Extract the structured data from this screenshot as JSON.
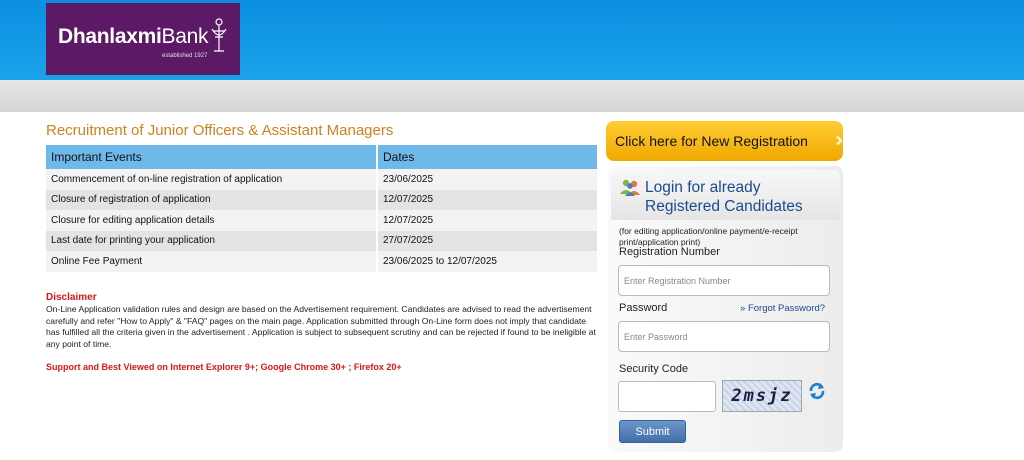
{
  "header": {
    "logo_name_bold": "Dhanlaxmi",
    "logo_name_light": "Bank",
    "logo_tagline": "established 1927",
    "colors": {
      "header_blue": "#0b8ee0",
      "logo_purple": "#5c1a66"
    }
  },
  "page": {
    "title": "Recruitment of Junior Officers & Assistant Managers"
  },
  "events_table": {
    "headers": [
      "Important Events",
      "Dates"
    ],
    "rows": [
      [
        "Commencement of on-line registration of application",
        "23/06/2025"
      ],
      [
        "Closure of registration of application",
        "12/07/2025"
      ],
      [
        "Closure for editing application details",
        "12/07/2025"
      ],
      [
        "Last date for printing your application",
        "27/07/2025"
      ],
      [
        "Online Fee Payment",
        "23/06/2025 to 12/07/2025"
      ]
    ]
  },
  "disclaimer": {
    "title": "Disclaimer",
    "text": "On-Line Application validation rules and design are based on the Advertisement requirement. Candidates are advised to read the advertisement carefully and refer \"How to Apply\" & \"FAQ\" pages on the main page. Application submitted through On-Line form does not imply that candidate has fulfilled all the criteria given in the advertisement . Application is subject to subsequent scrutiny and can be rejected if found to be ineligible at any point of time.",
    "support": "Support and Best Viewed on Internet Explorer 9+; Google Chrome 30+ ; Firefox 20+"
  },
  "registration": {
    "new_label": "Click here for New Registration",
    "chevron_icon": "double-chevron-right-icon"
  },
  "login": {
    "title_line1": "Login for already",
    "title_line2": "Registered Candidates",
    "subtitle": "(for editing application/online payment/e-receipt print/application print)",
    "reg_label": "Registration Number",
    "reg_placeholder": "Enter Registration Number",
    "password_label": "Password",
    "password_placeholder": "Enter Password",
    "forgot_label": "Forgot Password?",
    "security_label": "Security Code",
    "captcha_text": "2msjz",
    "submit_label": "Submit"
  }
}
